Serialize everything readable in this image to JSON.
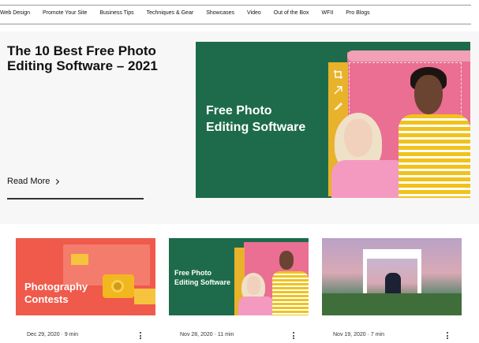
{
  "nav": {
    "items": [
      "Web Design",
      "Promote Your Site",
      "Business Tips",
      "Techniques & Gear",
      "Showcases",
      "Video",
      "Out of the Box",
      "WFII",
      "Pro Blogs"
    ]
  },
  "hero": {
    "title": "The 10 Best Free Photo Editing Software – 2021",
    "read_more": "Read More",
    "image_headline_line1": "Free Photo",
    "image_headline_line2": "Editing Software"
  },
  "cards": [
    {
      "title_line1": "Photography",
      "title_line2": "Contests",
      "date": "Dec 29, 2020",
      "read_time": "9 min"
    },
    {
      "title_line1": "Free Photo",
      "title_line2": "Editing Software",
      "date": "Nov 28, 2020",
      "read_time": "11 min"
    },
    {
      "date": "Nov 19, 2020",
      "read_time": "7 min"
    }
  ],
  "colors": {
    "green": "#1d6b4b",
    "pink": "#ea6f92",
    "yellow": "#e8b22a",
    "coral": "#ef5a4b"
  }
}
